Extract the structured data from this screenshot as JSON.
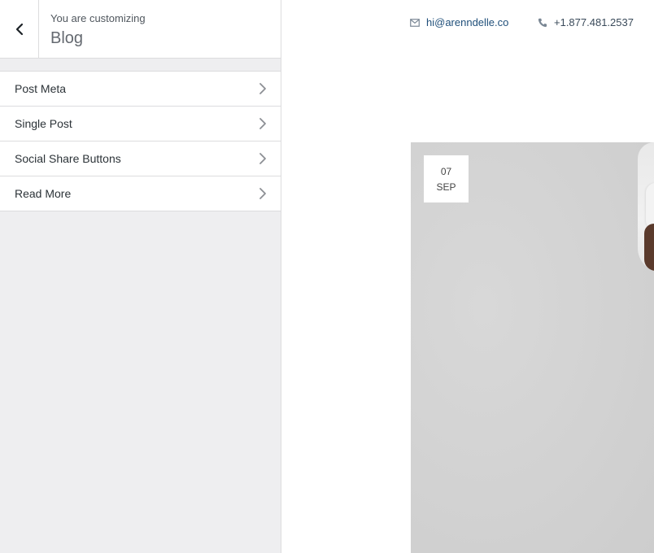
{
  "customizer": {
    "subtitle": "You are customizing",
    "title": "Blog",
    "back_icon": "chevron-left-icon",
    "items": [
      {
        "label": "Post Meta",
        "icon": "chevron-right-icon"
      },
      {
        "label": "Single Post",
        "icon": "chevron-right-icon"
      },
      {
        "label": "Social Share Buttons",
        "icon": "chevron-right-icon"
      },
      {
        "label": "Read More",
        "icon": "chevron-right-icon"
      }
    ]
  },
  "preview": {
    "header": {
      "email": {
        "icon": "envelope-icon",
        "text": "hi@arenndelle.co"
      },
      "phone": {
        "icon": "phone-icon",
        "text": "+1.877.481.2537"
      }
    },
    "post": {
      "date_day": "07",
      "date_month": "SEP"
    }
  },
  "colors": {
    "sidebar_bg": "#eeeef0",
    "border": "#dcdcde",
    "link_blue": "#1f4f7a",
    "icon_gray": "#7a8794"
  }
}
